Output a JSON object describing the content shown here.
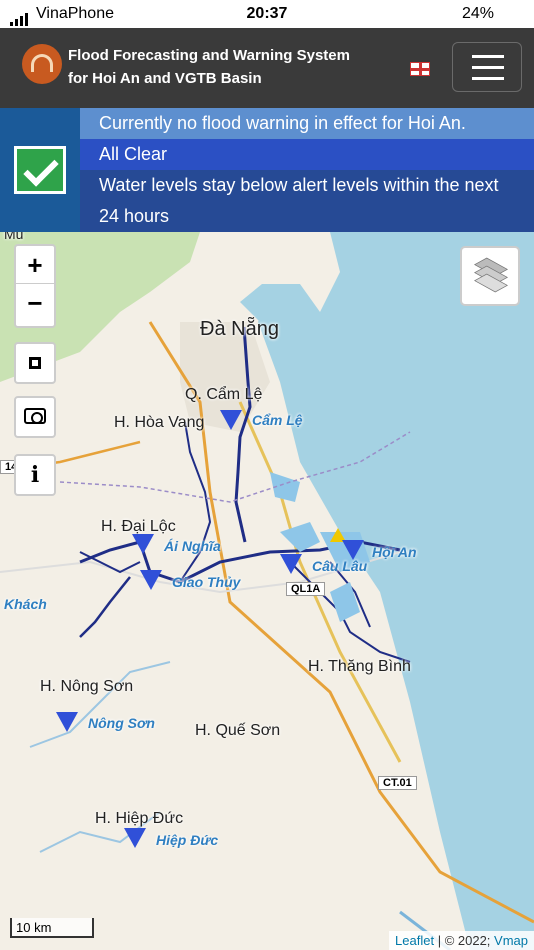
{
  "status_bar": {
    "carrier": "VinaPhone",
    "time": "20:37",
    "battery": "24%"
  },
  "header": {
    "title_line1": "Flood Forecasting and Warning System",
    "title_line2": "for Hoi An and VGTB Basin"
  },
  "alert": {
    "line1": "Currently no flood warning in effect for Hoi An.",
    "line2": "All Clear",
    "line3": "Water levels stay below alert levels within the next",
    "line4": "24 hours"
  },
  "map_controls": {
    "zoom_in": "+",
    "zoom_out": "−",
    "info": "i"
  },
  "places": {
    "da_nang": "Đà Nẵng",
    "cam_le": "Q. Cẩm Lệ",
    "hoa_vang": "H. Hòa Vang",
    "dai_loc": "H. Đại Lộc",
    "thang_binh": "H. Thăng Bình",
    "nong_son": "H. Nông Sơn",
    "que_son": "H. Quế Sơn",
    "hiep_duc": "H. Hiệp Đức",
    "khach": "Khách",
    "mu": "Mu"
  },
  "stations": {
    "cam_le": "Cẩm Lệ",
    "ai_nghia": "Ái Nghĩa",
    "giao_thuy": "Giao Thủy",
    "cau_lau": "Câu Lâu",
    "hoi_an": "Hội An",
    "nong_son": "Nông Sơn",
    "hiep_duc": "Hiệp Đức"
  },
  "road_labels": {
    "ql1a": "QL1A",
    "ct01": "CT.01",
    "r14": "14"
  },
  "scale_label": "10 km",
  "attribution": {
    "leaflet": "Leaflet",
    "sep": " | © 2022; ",
    "vmap": "Vmap"
  }
}
